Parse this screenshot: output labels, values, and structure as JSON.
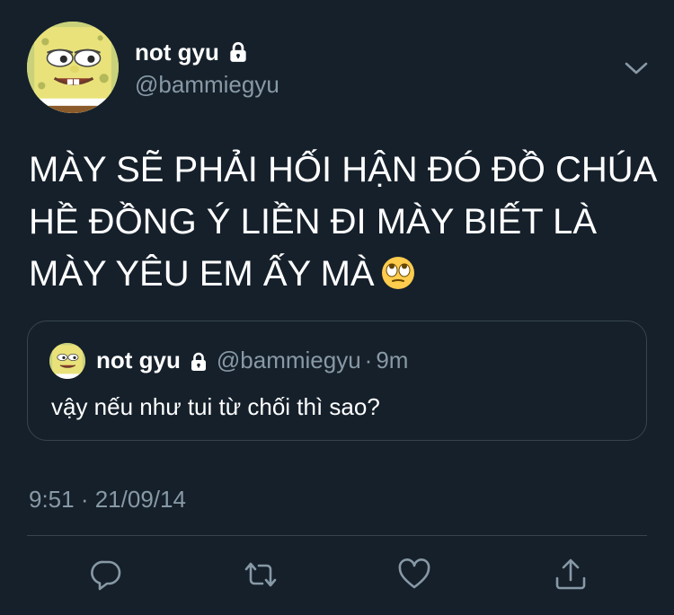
{
  "author": {
    "display_name": "not gyu",
    "handle": "@bammiegyu",
    "avatar_icon": "spongebob-avatar",
    "protected_icon": "lock-icon"
  },
  "tweet": {
    "text_lines": [
      "MÀY SẼ PHẢI HỐI HẬN ĐÓ ĐỒ CHÚA",
      "HỀ ĐỒNG Ý LIỀN ĐI MÀY BIẾT LÀ",
      "MÀY YÊU EM ẤY MÀ"
    ],
    "emoji": "face-with-rolling-eyes"
  },
  "quoted_tweet": {
    "display_name": "not gyu",
    "handle": "@bammiegyu",
    "separator": "·",
    "time": "9m",
    "text": "vậy nếu như tui từ chối thì sao?"
  },
  "meta": {
    "timestamp": "9:51 · 21/09/14"
  },
  "actions": [
    "reply-icon",
    "retweet-icon",
    "like-icon",
    "share-icon"
  ],
  "colors": {
    "background": "#15202b",
    "secondary_text": "#8899a6",
    "border": "#38444d",
    "primary_text": "#ffffff"
  }
}
